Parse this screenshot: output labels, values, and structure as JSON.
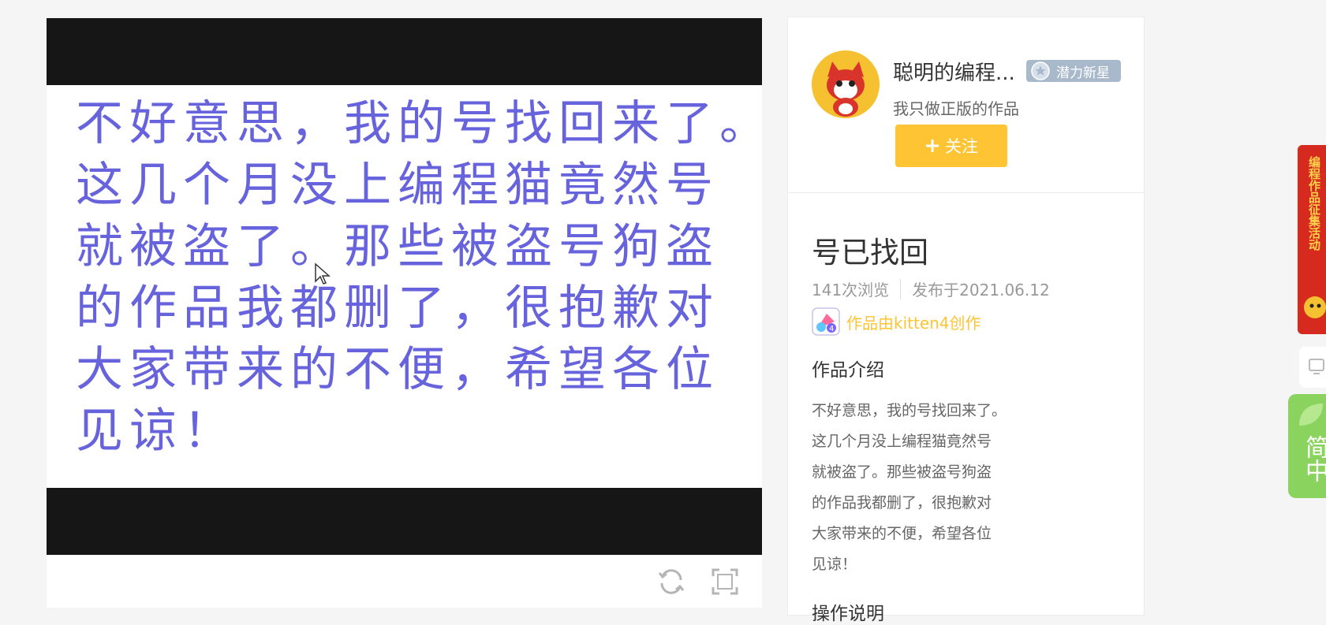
{
  "player": {
    "stage_lines": [
      "不好意思，我的号找回来了。",
      "这几个月没上编程猫竟然号",
      "就被盗了。那些被盗号狗盗",
      "的作品我都删了，很抱歉对",
      "大家带来的不便，希望各位",
      "见谅！"
    ],
    "controls": {
      "refresh_icon": "refresh-icon",
      "fullscreen_icon": "fullscreen-icon"
    }
  },
  "author": {
    "name": "聪明的编程...",
    "badge": "潜力新星",
    "bio": "我只做正版的作品",
    "follow_label": "关注",
    "follow_icon": "plus"
  },
  "work": {
    "title": "号已找回",
    "views": "141次浏览",
    "published": "发布于2021.06.12",
    "creator": "作品由kitten4创作",
    "intro_heading": "作品介绍",
    "intro_lines": [
      "不好意思，我的号找回来了。",
      "这几个月没上编程猫竟然号",
      "就被盗了。那些被盗号狗盗",
      "的作品我都删了，很抱歉对",
      "大家带来的不便，希望各位",
      "见谅！"
    ],
    "ops_heading": "操作说明"
  },
  "side": {
    "promo_text": "编程作品征集活动",
    "green_text": "简中"
  },
  "colors": {
    "stage_text": "#6663dc",
    "accent": "#fec433",
    "badge": "#a9b9cc",
    "promo": "#d62a1e",
    "green": "#8bd35f"
  }
}
